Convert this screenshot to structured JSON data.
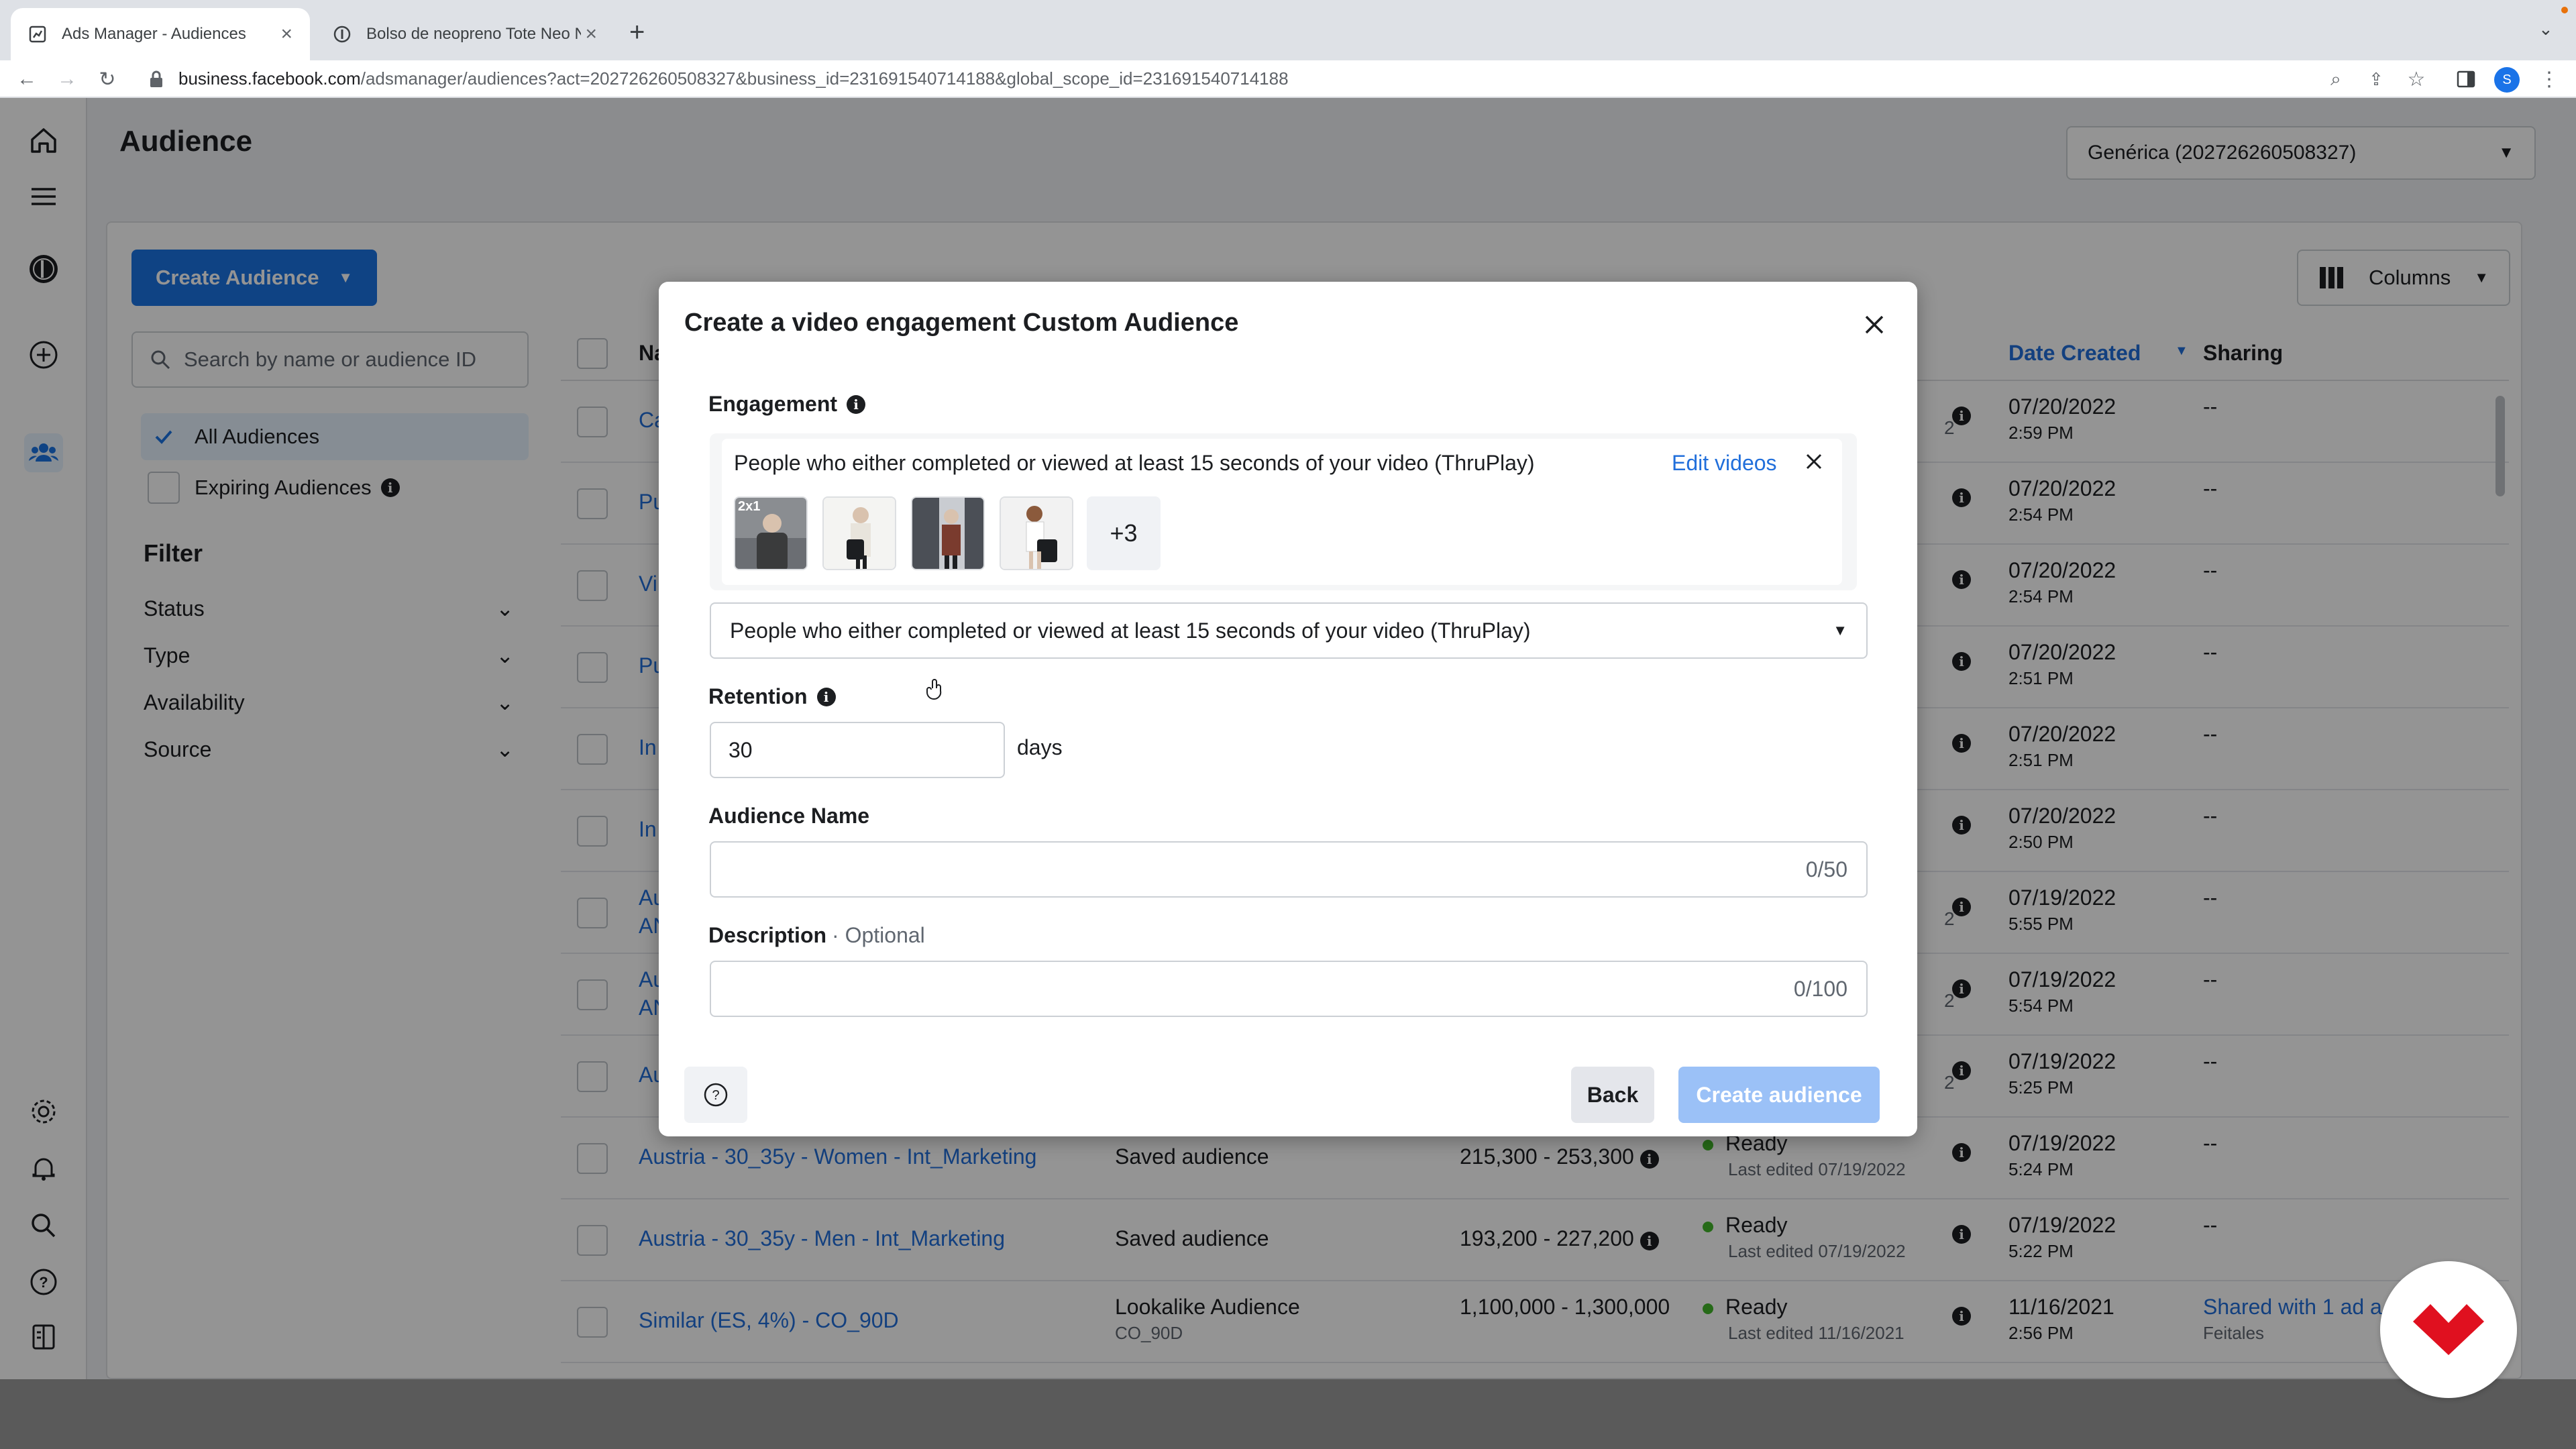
{
  "browser": {
    "tabs": [
      {
        "title": "Ads Manager - Audiences",
        "active": true
      },
      {
        "title": "Bolso de neopreno Tote Neo N",
        "active": false
      }
    ],
    "url_domain": "business.facebook.com",
    "url_path": "/adsmanager/audiences?act=202726260508327&business_id=231691540714188&global_scope_id=231691540714188",
    "profile_initial": "S"
  },
  "page": {
    "title": "Audience",
    "account_select": "Genérica (202726260508327)",
    "create_button": "Create Audience",
    "search_placeholder": "Search by name or audience ID",
    "all_audiences": "All Audiences",
    "expiring_audiences": "Expiring Audiences",
    "filter_heading": "Filter",
    "filters": [
      "Status",
      "Type",
      "Availability",
      "Source"
    ],
    "columns_button": "Columns"
  },
  "table": {
    "headers": {
      "name": "Na",
      "date_created": "Date Created",
      "sharing": "Sharing"
    },
    "rows": [
      {
        "name": "Ca",
        "type": "",
        "size": "",
        "status": "",
        "status_sub": "",
        "date": "07/20/2022",
        "time": "2:59 PM",
        "sharing": "--",
        "sharing_sub": "",
        "trail": "2"
      },
      {
        "name": "Pu",
        "type": "",
        "size": "",
        "status": "",
        "status_sub": "",
        "date": "07/20/2022",
        "time": "2:54 PM",
        "sharing": "--",
        "sharing_sub": "",
        "trail": ""
      },
      {
        "name": "Vi",
        "type": "",
        "size": "",
        "status": "",
        "status_sub": "",
        "date": "07/20/2022",
        "time": "2:54 PM",
        "sharing": "--",
        "sharing_sub": "",
        "trail": ""
      },
      {
        "name": "Pu",
        "type": "",
        "size": "",
        "status": "",
        "status_sub": "",
        "date": "07/20/2022",
        "time": "2:51 PM",
        "sharing": "--",
        "sharing_sub": "",
        "trail": ""
      },
      {
        "name": "In",
        "type": "",
        "size": "",
        "status": "",
        "status_sub": "",
        "date": "07/20/2022",
        "time": "2:51 PM",
        "sharing": "--",
        "sharing_sub": "",
        "trail": ""
      },
      {
        "name": "In",
        "type": "",
        "size": "",
        "status": "",
        "status_sub": "",
        "date": "07/20/2022",
        "time": "2:50 PM",
        "sharing": "--",
        "sharing_sub": "",
        "trail": ""
      },
      {
        "name": "Au",
        "name2": "AN",
        "type": "",
        "size": "",
        "status": "",
        "status_sub": "",
        "date": "07/19/2022",
        "time": "5:55 PM",
        "sharing": "--",
        "sharing_sub": "",
        "trail": "2"
      },
      {
        "name": "Au",
        "name2": "AN",
        "type": "",
        "size": "",
        "status": "",
        "status_sub": "",
        "date": "07/19/2022",
        "time": "5:54 PM",
        "sharing": "--",
        "sharing_sub": "",
        "trail": "2"
      },
      {
        "name": "Au",
        "type": "",
        "size": "",
        "status": "",
        "status_sub": "",
        "date": "07/19/2022",
        "time": "5:25 PM",
        "sharing": "--",
        "sharing_sub": "",
        "trail": "2"
      },
      {
        "name": "Austria - 30_35y - Women - Int_Marketing",
        "type": "Saved audience",
        "type_sub": "",
        "size": "215,300 - 253,300",
        "status": "Ready",
        "status_sub": "Last edited 07/19/2022",
        "date": "07/19/2022",
        "time": "5:24 PM",
        "sharing": "--",
        "sharing_sub": ""
      },
      {
        "name": "Austria - 30_35y - Men - Int_Marketing",
        "type": "Saved audience",
        "type_sub": "",
        "size": "193,200 - 227,200",
        "status": "Ready",
        "status_sub": "Last edited 07/19/2022",
        "date": "07/19/2022",
        "time": "5:22 PM",
        "sharing": "--",
        "sharing_sub": ""
      },
      {
        "name": "Similar (ES, 4%) - CO_90D",
        "type": "Lookalike Audience",
        "type_sub": "CO_90D",
        "size": "1,100,000 - 1,300,000",
        "status": "Ready",
        "status_sub": "Last edited 11/16/2021",
        "date": "11/16/2021",
        "time": "2:56 PM",
        "sharing": "Shared with 1 ad a",
        "sharing_sub": "Feitales"
      }
    ]
  },
  "modal": {
    "title": "Create a video engagement Custom Audience",
    "engagement_label": "Engagement",
    "engagement_text": "People who either completed or viewed at least 15 seconds of your video (ThruPlay)",
    "edit_videos": "Edit videos",
    "thumb_badge": "2x1",
    "more_count": "+3",
    "engagement_select": "People who either completed or viewed at least 15 seconds of your video (ThruPlay)",
    "retention_label": "Retention",
    "retention_value": "30",
    "retention_unit": "days",
    "name_label": "Audience Name",
    "name_counter": "0/50",
    "desc_label": "Description",
    "desc_optional": "· Optional",
    "desc_counter": "0/100",
    "back_button": "Back",
    "create_button": "Create audience"
  },
  "colors": {
    "accent": "#1b74e4",
    "link": "#216fdb",
    "ready": "#42b72a",
    "disabled_button": "#9bc1f7",
    "brand_badge": "#e0101f"
  }
}
